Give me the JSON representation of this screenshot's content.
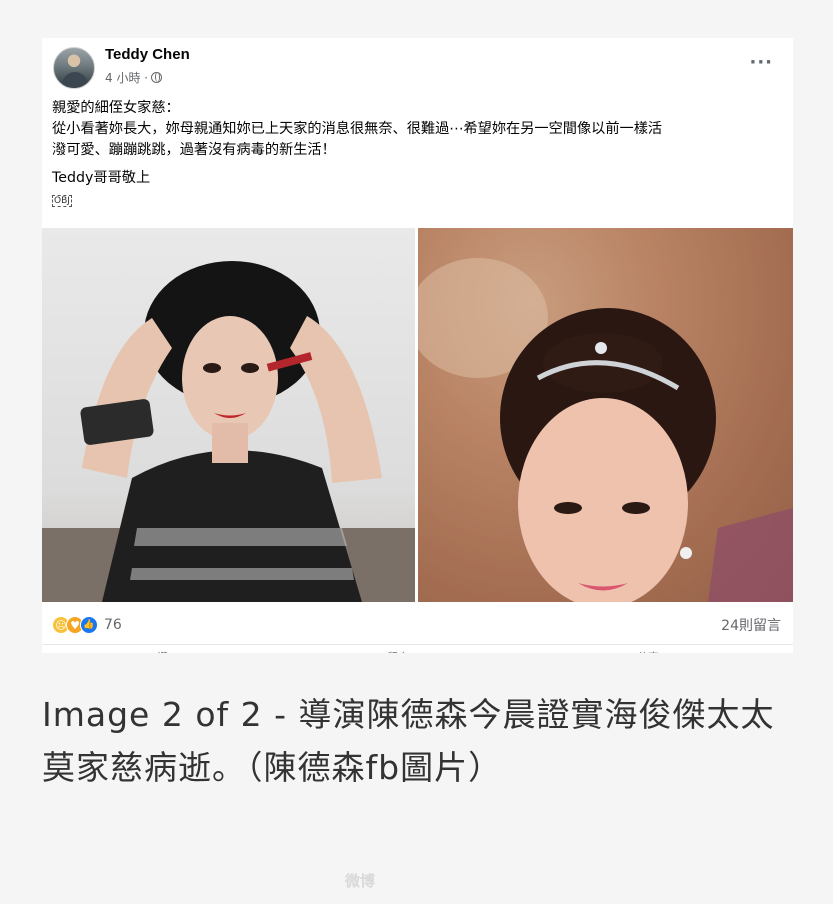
{
  "post": {
    "author": "Teddy Chen",
    "time": "4 小時 ·",
    "more": "···",
    "lines": [
      "親愛的細侄女家慈：",
      "從小看著妳長大，妳母親通知妳已上天家的消息很無奈、很難過⋯希望妳在另一空間像以前一樣活",
      "潑可愛、蹦蹦跳跳，過著沒有病毒的新生活！"
    ],
    "sign": "Teddy哥哥敬上",
    "obj_mark": "OBJ",
    "reactions": {
      "icons": [
        "sad-icon",
        "care-icon",
        "like-icon"
      ],
      "count": "76"
    },
    "comments": "24則留言",
    "actions": [
      "讚",
      "留言",
      "分享"
    ]
  },
  "caption": "Image 2 of 2 - 導演陳德森今晨證實海俊傑太太莫家慈病逝。（陳德森fb圖片）",
  "watermark": "微博",
  "colors": {
    "text": "#050505",
    "secondary": "#65676b",
    "like_blue": "#1877f2",
    "caption": "#333333"
  }
}
